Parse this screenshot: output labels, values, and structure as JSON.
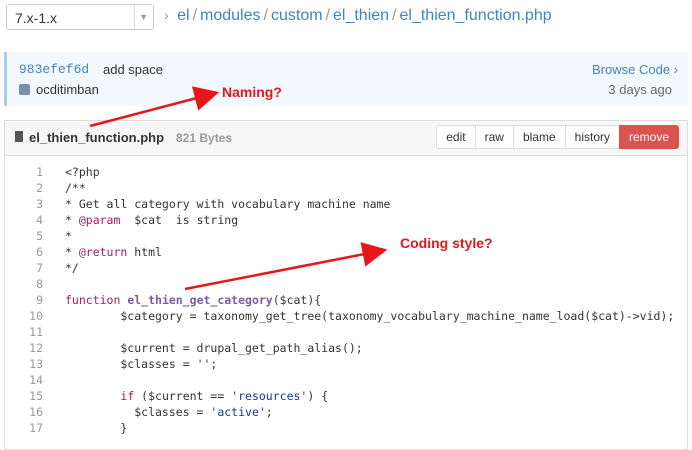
{
  "branch_selector": {
    "value": "7.x-1.x"
  },
  "breadcrumb": {
    "items": [
      "el",
      "modules",
      "custom",
      "el_thien",
      "el_thien_function.php"
    ],
    "separator": "/"
  },
  "commit": {
    "sha": "983efef6d",
    "message": "add space",
    "author": "ocditimban",
    "browse_label": "Browse Code ›",
    "time_ago": "3 days ago"
  },
  "file": {
    "name": "el_thien_function.php",
    "size": "821 Bytes",
    "buttons": [
      "edit",
      "raw",
      "blame",
      "history",
      "remove"
    ]
  },
  "code_lines": [
    {
      "n": "1",
      "t": "<?php"
    },
    {
      "n": "2",
      "t": "/**"
    },
    {
      "n": "3",
      "t": "* Get all category with vocabulary machine name"
    },
    {
      "n": "4",
      "t": "* @param  $cat  is string"
    },
    {
      "n": "5",
      "t": "*"
    },
    {
      "n": "6",
      "t": "* @return html"
    },
    {
      "n": "7",
      "t": "*/"
    },
    {
      "n": "8",
      "t": ""
    },
    {
      "n": "9",
      "t": "function el_thien_get_category($cat){"
    },
    {
      "n": "10",
      "t": "        $category = taxonomy_get_tree(taxonomy_vocabulary_machine_name_load($cat)->vid);"
    },
    {
      "n": "11",
      "t": ""
    },
    {
      "n": "12",
      "t": "        $current = drupal_get_path_alias();"
    },
    {
      "n": "13",
      "t": "        $classes = '';"
    },
    {
      "n": "14",
      "t": ""
    },
    {
      "n": "15",
      "t": "        if ($current == 'resources') {"
    },
    {
      "n": "16",
      "t": "          $classes = 'active';"
    },
    {
      "n": "17",
      "t": "        }"
    }
  ],
  "annotations": {
    "naming": "Naming?",
    "coding_style": "Coding style?",
    "color": "#e8161b"
  },
  "colors": {
    "link": "#4183c4",
    "remove_button": "#d9534f"
  }
}
